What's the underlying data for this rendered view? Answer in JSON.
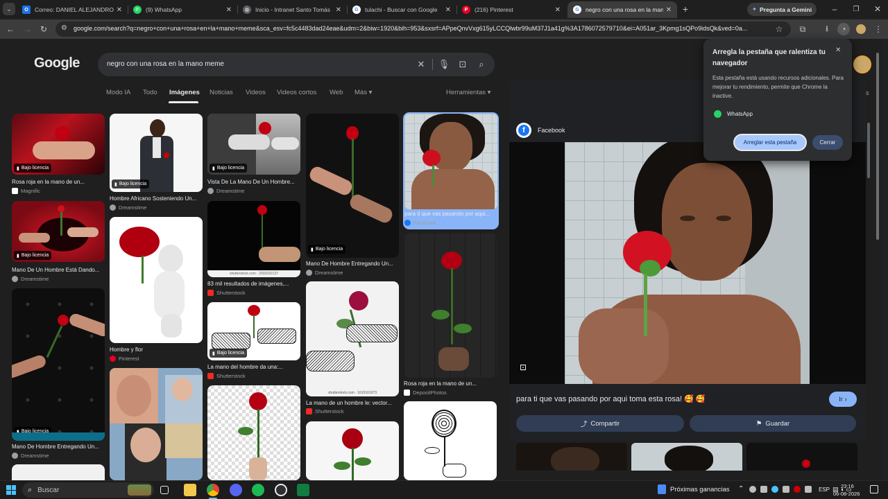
{
  "tabs": [
    {
      "title": "Correo: DANIEL ALEJANDRO CE",
      "color": "#1a73e8",
      "glyph": "O"
    },
    {
      "title": "(9) WhatsApp",
      "color": "#25d366",
      "glyph": "W"
    },
    {
      "title": "Inicio - Intranet Santo Tomás",
      "color": "#5f6368",
      "glyph": "S"
    },
    {
      "title": "tulachi - Buscar con Google",
      "color": "#ffffff",
      "glyph": "G"
    },
    {
      "title": "(216) Pinterest",
      "color": "#e60023",
      "glyph": "P"
    },
    {
      "title": "negro con una rosa en la mano",
      "color": "#ffffff",
      "glyph": "G"
    }
  ],
  "gemini_label": "Pregunta a Gemini",
  "url": "google.com/search?q=negro+con+una+rosa+en+la+mano+meme&sca_esv=fc5c4483dad24eae&udm=2&biw=1920&bih=953&sxsrf=APpeQnvVxg615yLCCQlwbr99uM37J1a41g%3A1786072579710&ei=A051ar_3Kpmg1sQPo9idsQk&ved=0a...",
  "google": {
    "logo": "Google",
    "query": "negro con una rosa en la mano meme",
    "nav_tabs": [
      "Modo IA",
      "Todo",
      "Imágenes",
      "Noticias",
      "Videos",
      "Videos cortos",
      "Web",
      "Más ▾"
    ],
    "tools": "Herramientas ▾",
    "right_cut_text": "dados"
  },
  "license_label": "Bajo licencia",
  "results": [
    {
      "caption": "Rosa roja en la mano de un...",
      "source": "Magnific",
      "src_color": "#ffffff"
    },
    {
      "caption": "Hombre Africano Sosteniendo Un...",
      "source": "Dreamstime",
      "src_color": "#9aa0a6"
    },
    {
      "caption": "Vista De La Mano De Un Hombre...",
      "source": "Dreamstime",
      "src_color": "#9aa0a6"
    },
    {
      "caption": "Mano De Hombre Entregando Un...",
      "source": "Dreamstime",
      "src_color": "#9aa0a6"
    },
    {
      "caption": "para ti que vas pasando por aqui...",
      "source": "Facebook",
      "src_color": "#1877f2"
    },
    {
      "caption": "Mano De Un Hombre Está Dando...",
      "source": "Dreamstime",
      "src_color": "#9aa0a6"
    },
    {
      "caption": "Hombre y flor",
      "source": "Pinterest",
      "src_color": "#e60023"
    },
    {
      "caption": "83 mil resultados de imágenes,...",
      "source": "Shutterstock",
      "src_color": "#ee2b24"
    },
    {
      "caption": "Rosa roja en la mano de un...",
      "source": "DepositPhotos",
      "src_color": "#ffffff"
    },
    {
      "caption": "La mano del hombre da una:...",
      "source": "Shutterstock",
      "src_color": "#ee2b24"
    },
    {
      "caption": "La mano de un hombre le: vector...",
      "source": "Shutterstock",
      "src_color": "#ee2b24"
    },
    {
      "caption": "Mano De Hombre Entregando Un...",
      "source": "Dreamstime",
      "src_color": "#9aa0a6"
    }
  ],
  "watermarks": {
    "shutterstock1": "shutterstock.com · 2032032137",
    "shutterstock2": "shutterstock.com · 1615161973"
  },
  "preview": {
    "source": "Facebook",
    "caption": "para ti que vas pasando por aqui toma esta rosa! 🥰 🥰",
    "go_button": "Ir",
    "share_button": "Compartir",
    "save_button": "Guardar"
  },
  "popup": {
    "title": "Arregla la pestaña que ralentiza tu navegador",
    "body": "Esta pestaña está usando recursos adicionales. Para mejorar tu rendimiento, permite que Chrome la inactive.",
    "app": "WhatsApp",
    "fix_button": "Arreglar esta pestaña",
    "close_button": "Cerrar"
  },
  "taskbar": {
    "search": "Buscar",
    "news": "Próximas ganancias",
    "lang": "ESP",
    "time": "23:16",
    "date": "06-08-2026"
  }
}
